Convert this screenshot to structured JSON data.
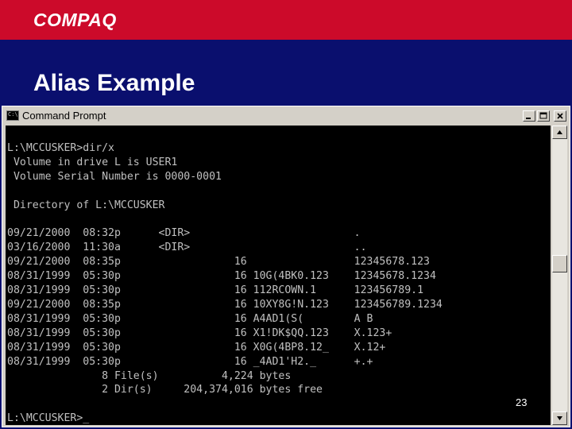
{
  "slide": {
    "logo": "COMPAQ",
    "title": "Alias Example",
    "page_number": "23"
  },
  "window": {
    "title": "Command Prompt",
    "icon_text": "C:\\"
  },
  "console": {
    "lines": [
      "L:\\MCCUSKER>dir/x",
      " Volume in drive L is USER1",
      " Volume Serial Number is 0000-0001",
      "",
      " Directory of L:\\MCCUSKER",
      "",
      "09/21/2000  08:32p      <DIR>                          .",
      "03/16/2000  11:30a      <DIR>                          ..",
      "09/21/2000  08:35p                  16                 12345678.123",
      "08/31/1999  05:30p                  16 10G(4BK0.123    12345678.1234",
      "08/31/1999  05:30p                  16 112RCOWN.1      123456789.1",
      "09/21/2000  08:35p                  16 10XY8G!N.123    123456789.1234",
      "08/31/1999  05:30p                  16 A4AD1(S(        A B",
      "08/31/1999  05:30p                  16 X1!DK$QQ.123    X.123+",
      "08/31/1999  05:30p                  16 X0G(4BP8.12_    X.12+",
      "08/31/1999  05:30p                  16 _4AD1'H2._      +.+",
      "               8 File(s)          4,224 bytes",
      "               2 Dir(s)     204,374,016 bytes free",
      "",
      "L:\\MCCUSKER>_"
    ]
  },
  "colors": {
    "header_red": "#cc0a2a",
    "background_navy": "#0a0f6e",
    "console_bg": "#000000",
    "console_text": "#c0c0c0"
  },
  "icons": {
    "minimize": "minimize-icon",
    "maximize": "maximize-icon",
    "close": "close-icon",
    "scroll_up": "arrow-up-icon",
    "scroll_down": "arrow-down-icon"
  }
}
